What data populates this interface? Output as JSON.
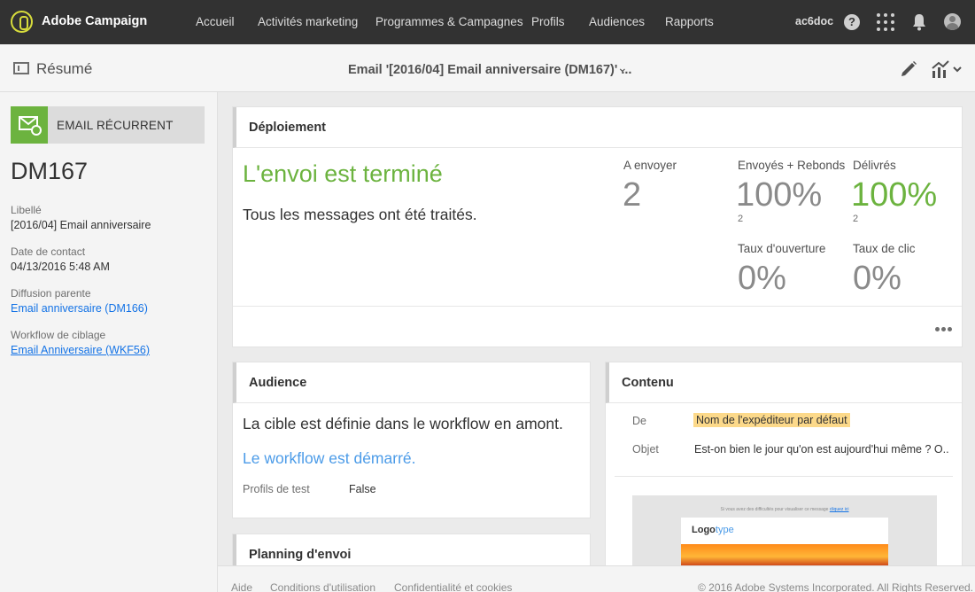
{
  "topbar": {
    "brand": "Adobe Campaign",
    "nav": [
      "Accueil",
      "Activités marketing",
      "Programmes & Campagnes",
      "Profils",
      "Audiences",
      "Rapports"
    ],
    "user_id": "ac6doc",
    "help_glyph": "?"
  },
  "subbar": {
    "summary_label": "Résumé",
    "title": "Email '[2016/04] Email anniversaire (DM167)' ...",
    "chevron": "⌄"
  },
  "left": {
    "badge_label": "EMAIL RÉCURRENT",
    "code": "DM167",
    "fields": [
      {
        "label": "Libellé",
        "value": "[2016/04] Email anniversaire"
      },
      {
        "label": "Date de contact",
        "value": "04/13/2016 5:48 AM"
      },
      {
        "label": "Diffusion parente",
        "value": "Email anniversaire (DM166)"
      },
      {
        "label": "Workflow de ciblage",
        "value": "Email Anniversaire (WKF56)"
      }
    ]
  },
  "deploy": {
    "title": "Déploiement",
    "status": "L'envoi est terminé",
    "message": "Tous les messages ont été traités.",
    "kpis": {
      "to_send": {
        "label": "A envoyer",
        "value": "2"
      },
      "sent": {
        "label": "Envoyés + Rebonds",
        "value": "100%",
        "count": "2"
      },
      "delivered": {
        "label": "Délivrés",
        "value": "100%",
        "count": "2"
      },
      "open_rate": {
        "label": "Taux d'ouverture",
        "value": "0%"
      },
      "click_rate": {
        "label": "Taux de clic",
        "value": "0%"
      }
    }
  },
  "audience": {
    "title": "Audience",
    "target_text": "La cible est définie dans le workflow en amont.",
    "workflow_status": "Le workflow est démarré.",
    "test_profiles_label": "Profils de test",
    "test_profiles_value": "False"
  },
  "content": {
    "title": "Contenu",
    "from_label": "De",
    "from_value": "Nom de l'expéditeur par défaut",
    "subject_label": "Objet",
    "subject_value": "Est-on bien le jour qu'on est aujourd'hui même ? O..",
    "preview_logo_a": "Logo",
    "preview_logo_b": "type"
  },
  "planning": {
    "title": "Planning d'envoi"
  },
  "footer": {
    "links": [
      "Aide",
      "Conditions d'utilisation",
      "Confidentialité et cookies"
    ],
    "copyright": "© 2016 Adobe Systems Incorporated. All Rights Reserved."
  },
  "colors": {
    "accent_green": "#6cb33f",
    "link_blue": "#1473e6",
    "topbar": "#323232",
    "highlight": "#fcd98a"
  }
}
